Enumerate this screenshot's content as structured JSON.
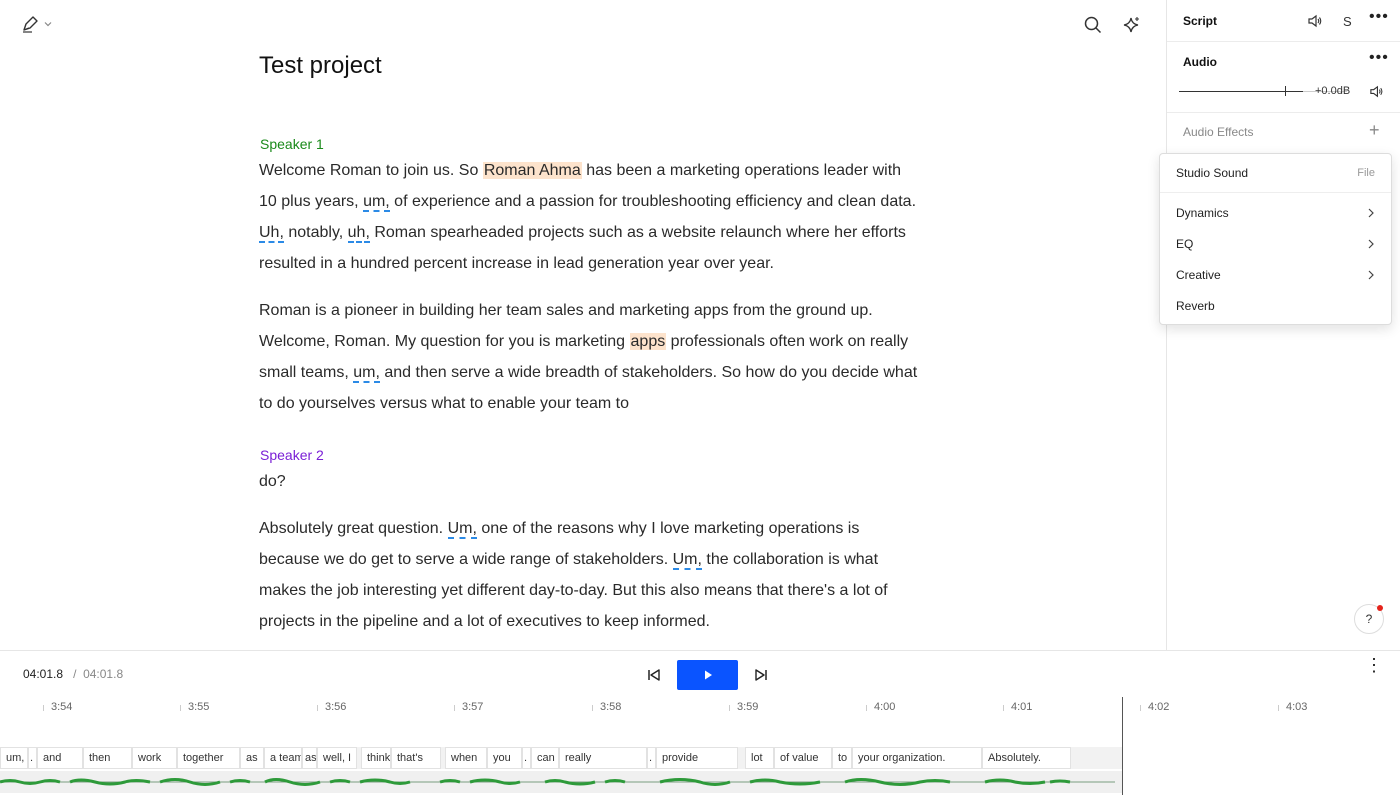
{
  "project": {
    "title": "Test project"
  },
  "transcript": {
    "speaker1": "Speaker 1",
    "speaker2": "Speaker 2",
    "p1": {
      "a": "Welcome Roman to join us. So ",
      "hl": "Roman Ahma",
      "b": " has been a marketing operations leader with 10 plus years, ",
      "f1": "um,",
      "c": " of experience and a passion for troubleshooting efficiency and clean data. ",
      "f2": "Uh,",
      "d": " notably, ",
      "f3": "uh,",
      "e": " Roman spearheaded projects such as a website relaunch where her efforts resulted in a hundred percent increase in lead generation year over year."
    },
    "p2": {
      "a": "Roman is a pioneer in building her team sales and marketing apps from the ground up. Welcome, Roman. My question for you is marketing ",
      "hl": "apps",
      "b": " professionals often work on really small teams, ",
      "f1": "um,",
      "c": " and then serve a wide breadth of stakeholders. So how do you decide what to do yourselves versus what to enable your team to"
    },
    "p3": "do?",
    "p4": {
      "a": "Absolutely great question. ",
      "f1": "Um,",
      "b": " one of the reasons why I love marketing operations is because we do get to serve a wide range of stakeholders. ",
      "f2": "Um,",
      "c": " the collaboration is what makes the job interesting yet different day-to-day. But this also means that there's a lot of projects in the pipeline and a lot of executives to keep informed."
    }
  },
  "right_panel": {
    "script_label": "Script",
    "s_label": "S",
    "audio_label": "Audio",
    "gain": "+0.0dB",
    "gain_level_fraction": 0.68,
    "audio_effects_label": "Audio Effects"
  },
  "effects_menu": {
    "studio_sound": "Studio Sound",
    "file_label": "File",
    "items": [
      "Dynamics",
      "EQ",
      "Creative",
      "Reverb"
    ]
  },
  "help_label": "?",
  "player": {
    "current": "04:01.8",
    "separator": "/",
    "total": "04:01.8"
  },
  "timeline": {
    "ticks": [
      "3:54",
      "3:55",
      "3:56",
      "3:57",
      "3:58",
      "3:59",
      "4:00",
      "4:01",
      "4:02",
      "4:03"
    ],
    "words": [
      "um,",
      ".",
      "and",
      "then",
      "work",
      "together",
      "as",
      "a team",
      "as",
      "well, I",
      "think",
      "that's",
      "when",
      "you",
      ".",
      "can",
      "really",
      ".",
      "provide",
      "lot",
      "of value",
      "to",
      "your organization.",
      "Absolutely."
    ]
  },
  "colors": {
    "accent": "#0a54ff",
    "speaker1": "#1a8a1a",
    "speaker2": "#7a1fd6",
    "highlight": "#fde3cc",
    "waveform": "#2e9a3a"
  }
}
